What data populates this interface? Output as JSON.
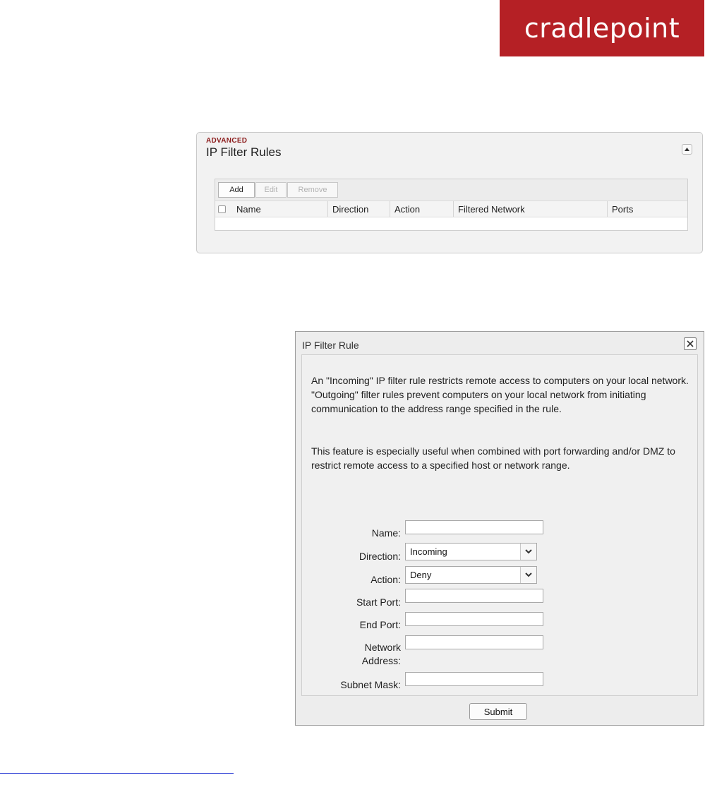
{
  "logo": {
    "text": "cradlepoint",
    "color": "#b52025"
  },
  "panel": {
    "pretitle": "ADVANCED",
    "title": "IP Filter Rules",
    "toolbar": {
      "add": "Add",
      "edit": "Edit",
      "remove": "Remove"
    },
    "columns": [
      "Name",
      "Direction",
      "Action",
      "Filtered Network",
      "Ports"
    ],
    "rows": []
  },
  "dialog": {
    "title": "IP Filter Rule",
    "paragraph1": "An \"Incoming\" IP filter rule restricts remote access to computers on your local network. \"Outgoing\" filter rules prevent computers on your local network from initiating communication to the address range specified in the rule.",
    "paragraph2": "This feature is especially useful when combined with port forwarding and/or DMZ to restrict remote access to a specified host or network range.",
    "fields": {
      "name_label": "Name:",
      "name_value": "",
      "direction_label": "Direction:",
      "direction_value": "Incoming",
      "action_label": "Action:",
      "action_value": "Deny",
      "start_port_label": "Start Port:",
      "start_port_value": "",
      "end_port_label": "End Port:",
      "end_port_value": "",
      "network_address_label_line1": "Network",
      "network_address_label_line2": "Address:",
      "network_address_value": "",
      "subnet_mask_label": "Subnet Mask:",
      "subnet_mask_value": ""
    },
    "submit": "Submit"
  }
}
